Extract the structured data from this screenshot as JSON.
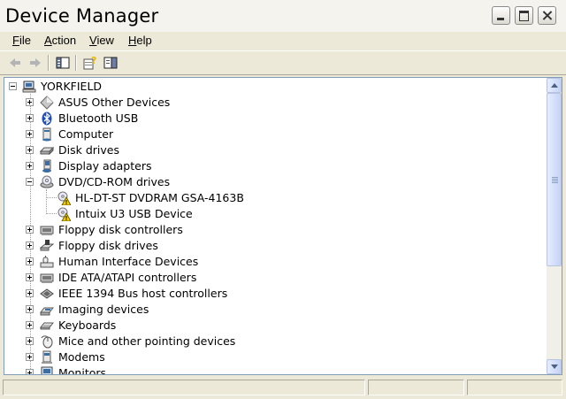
{
  "window": {
    "title": "Device Manager"
  },
  "menu": [
    {
      "label": "File",
      "mnemonic": "F",
      "rest": "ile"
    },
    {
      "label": "Action",
      "mnemonic": "A",
      "rest": "ction"
    },
    {
      "label": "View",
      "mnemonic": "V",
      "rest": "iew"
    },
    {
      "label": "Help",
      "mnemonic": "H",
      "rest": "elp"
    }
  ],
  "toolbar": {
    "buttons": [
      "back-arrow-icon",
      "forward-arrow-icon",
      "show-hide-console-tree-icon",
      "properties-help-icon",
      "show-action-pane-icon"
    ]
  },
  "tree": {
    "root": {
      "label": "YORKFIELD",
      "icon": "computer-icon",
      "expanded": true
    },
    "items": [
      {
        "label": "ASUS Other Devices",
        "icon": "diamond-icon",
        "expanded": false
      },
      {
        "label": "Bluetooth USB",
        "icon": "bluetooth-icon",
        "expanded": false
      },
      {
        "label": "Computer",
        "icon": "computer-icon",
        "expanded": false
      },
      {
        "label": "Disk drives",
        "icon": "disk-drive-icon",
        "expanded": false
      },
      {
        "label": "Display adapters",
        "icon": "display-adapter-icon",
        "expanded": false
      },
      {
        "label": "DVD/CD-ROM drives",
        "icon": "cdrom-icon",
        "expanded": true,
        "children": [
          {
            "label": "HL-DT-ST DVDRAM GSA-4163B",
            "icon": "cdrom-warning-icon"
          },
          {
            "label": "Intuix U3 USB Device",
            "icon": "cdrom-warning-icon"
          }
        ]
      },
      {
        "label": "Floppy disk controllers",
        "icon": "controller-icon",
        "expanded": false
      },
      {
        "label": "Floppy disk drives",
        "icon": "floppy-drive-icon",
        "expanded": false
      },
      {
        "label": "Human Interface Devices",
        "icon": "hid-icon",
        "expanded": false
      },
      {
        "label": "IDE ATA/ATAPI controllers",
        "icon": "controller-icon",
        "expanded": false
      },
      {
        "label": "IEEE 1394 Bus host controllers",
        "icon": "ieee1394-icon",
        "expanded": false
      },
      {
        "label": "Imaging devices",
        "icon": "camera-icon",
        "expanded": false
      },
      {
        "label": "Keyboards",
        "icon": "keyboard-icon",
        "expanded": false
      },
      {
        "label": "Mice and other pointing devices",
        "icon": "mouse-icon",
        "expanded": false
      },
      {
        "label": "Modems",
        "icon": "modem-icon",
        "expanded": false
      },
      {
        "label": "Monitors",
        "icon": "monitor-icon",
        "expanded": false
      }
    ]
  },
  "colors": {
    "accent": "#3a6ea5",
    "warning": "#f5d100",
    "tree_border": "#7f9db9"
  }
}
